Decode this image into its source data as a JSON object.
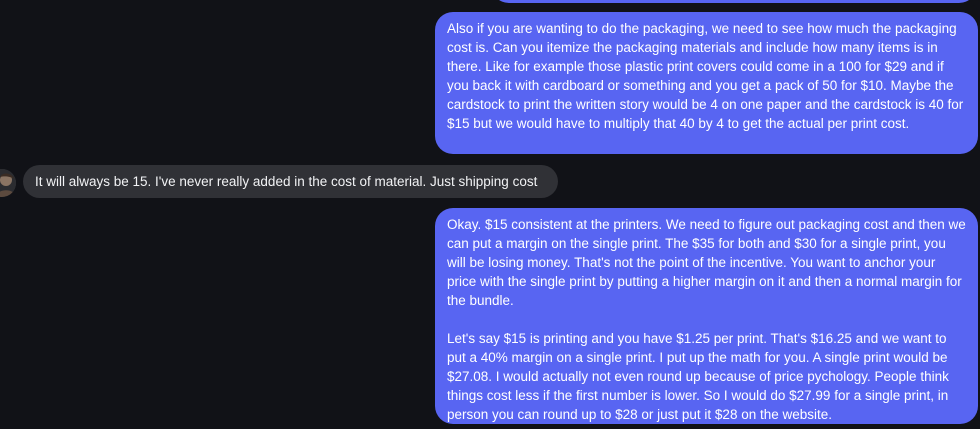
{
  "chat": {
    "messages": [
      {
        "from": "me",
        "paragraphs": [
          "Also if you are wanting to do the packaging, we need to see how much the packaging cost is. Can you itemize the packaging materials and include how many items is in there. Like for example those plastic print covers could come in a 100 for $29 and if you back it with cardboard or something and you get a pack of 50 for $10. Maybe the cardstock to print the written story would be 4 on one paper and the cardstock is 40 for $15 but we would have to multiply that 40 by 4 to get the actual per print cost."
        ]
      },
      {
        "from": "them",
        "paragraphs": [
          "It will always be 15. I've never really added in the cost of material. Just shipping cost"
        ]
      },
      {
        "from": "me",
        "paragraphs": [
          "Okay. $15 consistent at the printers. We need to figure out packaging cost and then we can put a margin on the single print. The $35 for both and $30 for a single print, you will be losing money. That's not the point of the incentive. You want to anchor your price with the single print by putting a higher margin on it and then a normal margin for the bundle.",
          "Let's say $15 is printing and you have $1.25 per print. That's $16.25 and we want to put a 40% margin on a single print. I put up the math for you. A single print would be $27.08. I would actually not even round up because of price pychology. People think things cost less if the first number is lower. So I would do $27.99 for a single print, in person you can round up to $28 or just put it $28 on the website."
        ]
      }
    ]
  },
  "colors": {
    "background": "#111217",
    "outgoing_bubble": "#5865f2",
    "incoming_bubble": "#303136"
  }
}
